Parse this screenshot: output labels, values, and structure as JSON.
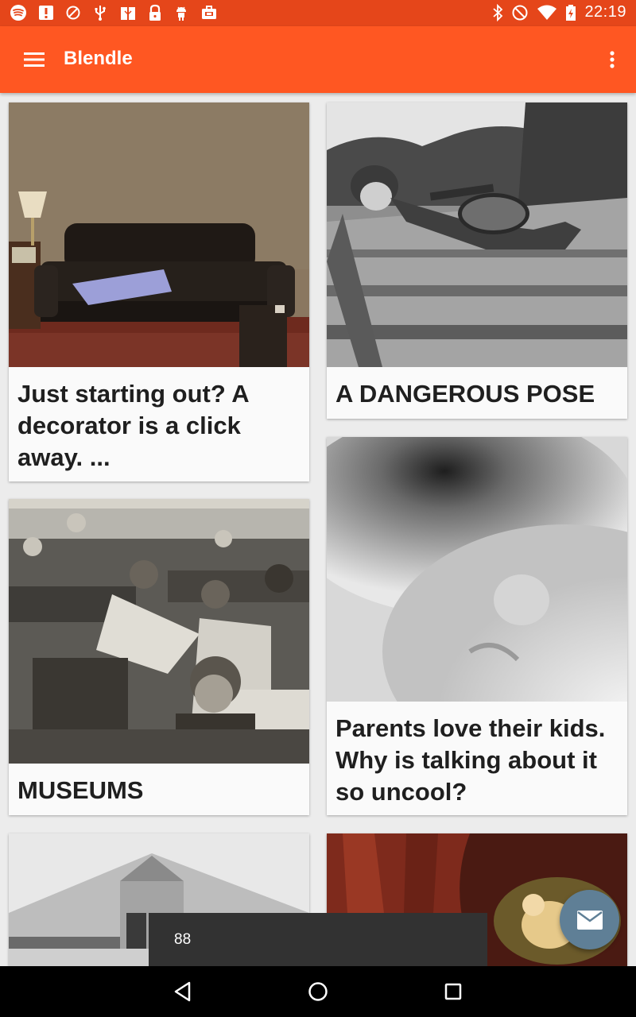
{
  "status_bar": {
    "time": "22:19",
    "left_icons": [
      "spotify-icon",
      "alert-icon",
      "blocked-icon",
      "usb-icon",
      "gift-icon",
      "lock-icon",
      "android-icon",
      "briefcase-icon"
    ],
    "right_icons": [
      "bluetooth-icon",
      "do-not-disturb-icon",
      "wifi-icon",
      "battery-icon"
    ]
  },
  "app_bar": {
    "title": "Blendle",
    "color": "#FF5722"
  },
  "cards": [
    {
      "title": "Just starting out? A decorator is a click away. ...",
      "image": "living-room-sofa-photo"
    },
    {
      "title": "A DANGEROUS POSE",
      "image": "man-on-railroad-guitar-photo"
    },
    {
      "title": "MUSEUMS",
      "image": "vintage-classroom-photo"
    },
    {
      "title": "Parents love their kids. Why is talking about it so uncool?",
      "image": "baby-face-closeup-photo"
    },
    {
      "title": "",
      "image": "white-barn-building-photo"
    },
    {
      "title": "",
      "image": "classical-painting-red-curtain"
    }
  ],
  "snackbar": {
    "text": "88"
  },
  "fab": {
    "icon": "mail-icon",
    "color": "#5F7F96"
  },
  "nav_bar": {
    "buttons": [
      "back-icon",
      "home-icon",
      "recents-icon"
    ]
  }
}
